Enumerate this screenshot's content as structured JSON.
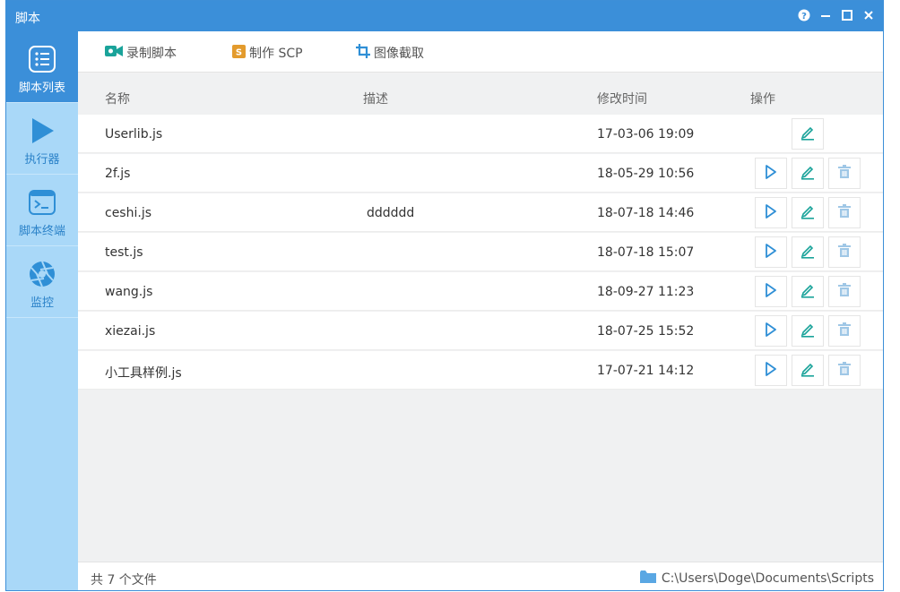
{
  "window": {
    "title": "脚本"
  },
  "sidebar": {
    "items": [
      {
        "label": "脚本列表",
        "icon": "list-icon"
      },
      {
        "label": "执行器",
        "icon": "play-icon"
      },
      {
        "label": "脚本终端",
        "icon": "terminal-icon"
      },
      {
        "label": "监控",
        "icon": "aperture-icon"
      }
    ]
  },
  "toolbar": {
    "record_label": "录制脚本",
    "scp_label": "制作 SCP",
    "capture_label": "图像截取"
  },
  "table": {
    "headers": {
      "name": "名称",
      "desc": "描述",
      "time": "修改时间",
      "ops": "操作"
    },
    "rows": [
      {
        "name": "Userlib.js",
        "desc": "",
        "time": "17-03-06 19:09"
      },
      {
        "name": "2f.js",
        "desc": "",
        "time": "18-05-29 10:56"
      },
      {
        "name": "ceshi.js",
        "desc": "dddddd",
        "time": "18-07-18 14:46"
      },
      {
        "name": "test.js",
        "desc": "",
        "time": "18-07-18 15:07"
      },
      {
        "name": "wang.js",
        "desc": "",
        "time": "18-09-27 11:23"
      },
      {
        "name": "xiezai.js",
        "desc": "",
        "time": "18-07-25 15:52"
      },
      {
        "name": "小工具样例.js",
        "desc": "",
        "time": "17-07-21 14:12"
      }
    ]
  },
  "status": {
    "count": "共 7 个文件",
    "path": "C:\\Users\\Doge\\Documents\\Scripts"
  },
  "colors": {
    "accent": "#3b8fd9",
    "sidebar": "#a9d8f8",
    "action_blue": "#2f8fd6",
    "action_teal": "#1aa39a",
    "trash": "#9fc7e6"
  }
}
